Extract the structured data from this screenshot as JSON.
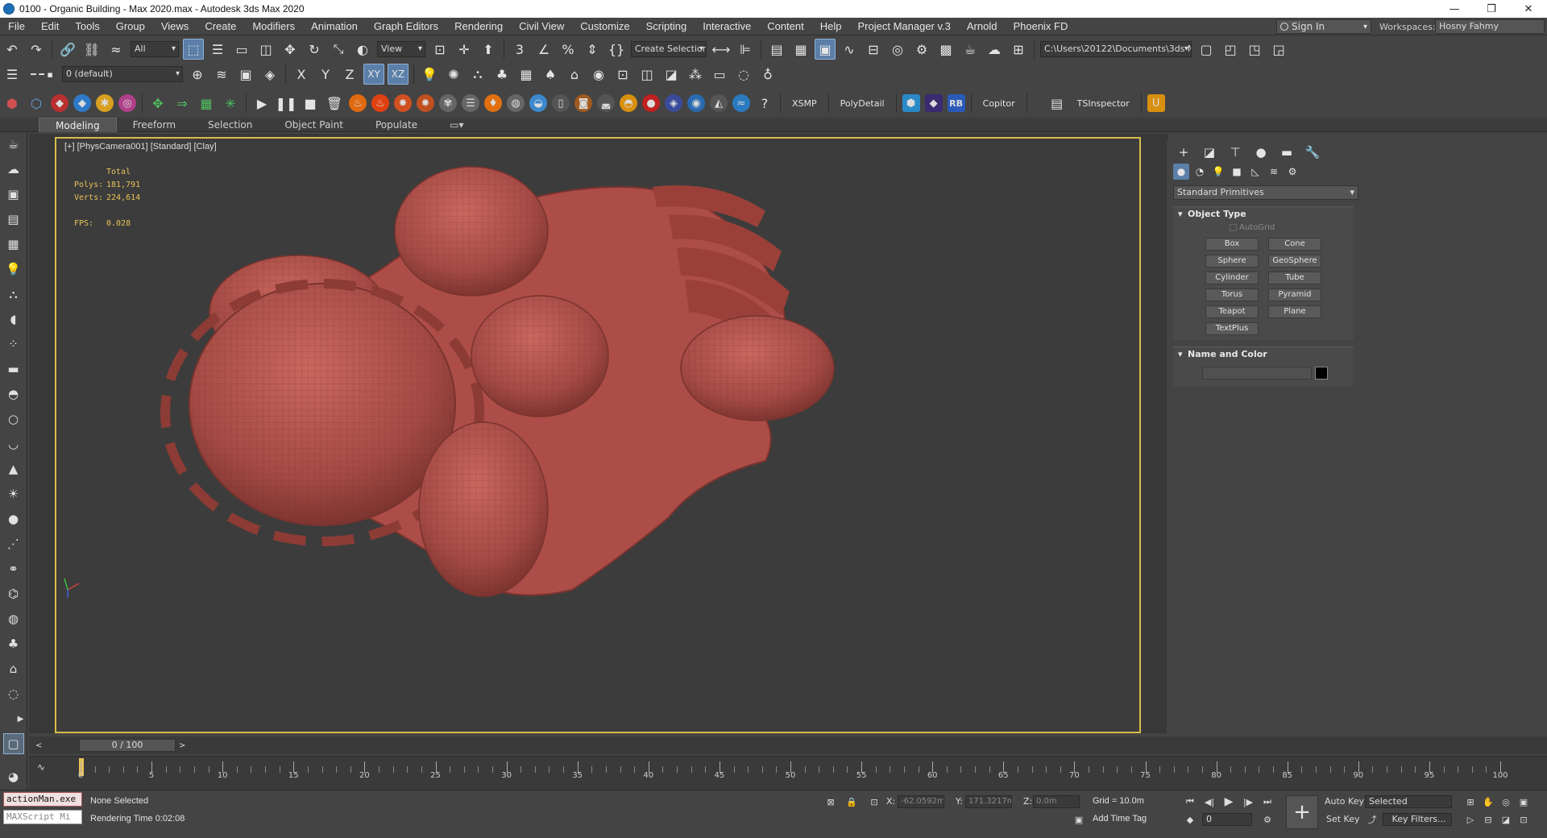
{
  "window": {
    "title": "0100 - Organic Building - Max 2020.max - Autodesk 3ds Max 2020"
  },
  "menu": [
    "File",
    "Edit",
    "Tools",
    "Group",
    "Views",
    "Create",
    "Modifiers",
    "Animation",
    "Graph Editors",
    "Rendering",
    "Civil View",
    "Customize",
    "Scripting",
    "Interactive",
    "Content",
    "Help",
    "Project Manager v.3",
    "Arnold",
    "Phoenix FD"
  ],
  "account": {
    "signin_label": "Sign In",
    "workspaces_label": "Workspaces:",
    "workspace_value": "Hosny Fahmy"
  },
  "toolbar1": {
    "filter_value": "All",
    "refcoord_value": "View",
    "selection_set_value": "Create Selection Se",
    "project_path": "C:\\Users\\20122\\Documents\\3ds Max 2020"
  },
  "toolbar2": {
    "layer_value": "0 (default)",
    "axis_x": "X",
    "axis_y": "Y",
    "axis_z": "Z",
    "axis_xy": "XY",
    "axis_xz": "XZ"
  },
  "toolbar3": {
    "xsmp": "XSMP",
    "polydetail": "PolyDetail",
    "rb": "RB",
    "copitor": "Copitor",
    "tsinspector": "TSInspector"
  },
  "ribbon_tabs": [
    "Modeling",
    "Freeform",
    "Selection",
    "Object Paint",
    "Populate"
  ],
  "viewport": {
    "label": "[+] [PhysCamera001] [Standard] [Clay]",
    "stats_total": "Total",
    "polys_label": "Polys:",
    "polys_value": "181,791",
    "verts_label": "Verts:",
    "verts_value": "224,614",
    "fps_label": "FPS:",
    "fps_value": "0.028",
    "model_color": "#b5524c"
  },
  "command_panel": {
    "category_value": "Standard Primitives",
    "object_type_header": "Object Type",
    "autogrid_label": "AutoGrid",
    "primitives": [
      "Box",
      "Cone",
      "Sphere",
      "GeoSphere",
      "Cylinder",
      "Tube",
      "Torus",
      "Pyramid",
      "Teapot",
      "Plane",
      "TextPlus"
    ],
    "name_color_header": "Name and Color"
  },
  "timeline": {
    "frame_display": "0 / 100",
    "tick_labels": [
      0,
      5,
      10,
      15,
      20,
      25,
      30,
      35,
      40,
      45,
      50,
      55,
      60,
      65,
      70,
      75,
      80,
      85,
      90,
      95,
      100
    ]
  },
  "status": {
    "maxscript_line1": "actionMan.exe",
    "maxscript_line2": "MAXScript Mi",
    "selection_status": "None Selected",
    "rendering_time": "Rendering Time  0:02:08",
    "x_label": "X:",
    "x_value": "-62.0592m",
    "y_label": "Y:",
    "y_value": "171.3217m",
    "z_label": "Z:",
    "z_value": "0.0m",
    "grid": "Grid = 10.0m",
    "add_time_tag": "Add Time Tag",
    "auto_key": "Auto Key",
    "set_key": "Set Key",
    "selected_value": "Selected",
    "key_filters": "Key Filters...",
    "frame_value": "0"
  }
}
